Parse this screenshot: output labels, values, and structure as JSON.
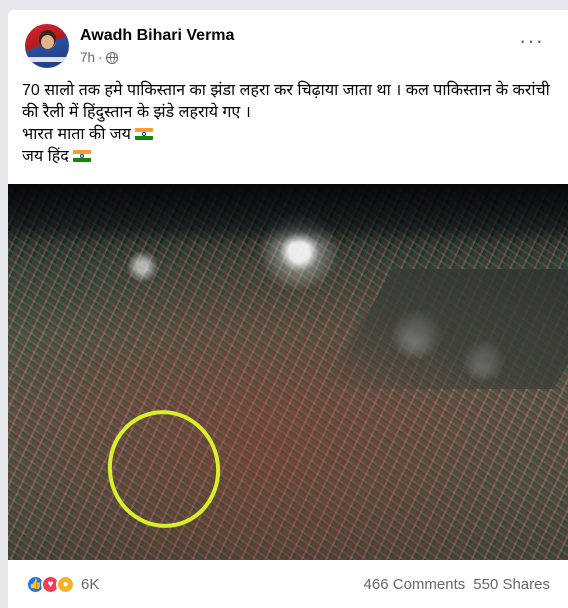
{
  "post": {
    "author": "Awadh Bihari Verma",
    "time": "7h",
    "dot": "·",
    "more_icon": "more-options-icon",
    "text_line1": "70 सालो तक हमे पाकिस्तान का झंडा लहरा कर चिढ़ाया जाता था । कल पाकिस्तान के करांची की रैली में हिंदुस्तान के झंडे लहराये गए ।",
    "text_line2": "भारत माता की जय",
    "text_line3": "जय हिंद"
  },
  "photo": {
    "description_icon": "rally-crowd-photo",
    "highlight_color": "#d8f027"
  },
  "reactions": {
    "icons": [
      "like-icon",
      "love-icon",
      "wow-icon"
    ],
    "count": "6K",
    "comments": "466 Comments",
    "shares": "550 Shares"
  },
  "colors": {
    "brand_blue": "#1877f2",
    "secondary_text": "#65676b"
  }
}
